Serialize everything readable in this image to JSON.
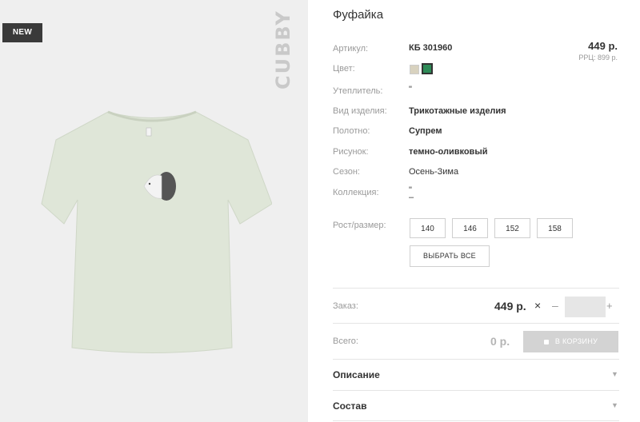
{
  "product": {
    "badge": "NEW",
    "brand": "CUBBY",
    "title": "Фуфайка",
    "price": "449 р.",
    "rrp": "РРЦ: 899 р."
  },
  "specs": {
    "article_label": "Артикул:",
    "article_value": "КБ 301960",
    "color_label": "Цвет:",
    "insulation_label": "Утеплитель:",
    "insulation_value": "\"",
    "type_label": "Вид изделия:",
    "type_value": "Трикотажные изделия",
    "fabric_label": "Полотно:",
    "fabric_value": "Супрем",
    "pattern_label": "Рисунок:",
    "pattern_value": "темно-оливковый",
    "season_label": "Сезон:",
    "season_value": "Осень-Зима",
    "collection_label": "Коллекция:",
    "collection_value": "\"",
    "collection_value2": "–"
  },
  "colors": [
    "#d8d2bf",
    "#2e8b57"
  ],
  "sizes": {
    "label": "Рост/размер:",
    "options": [
      "140",
      "146",
      "152",
      "158"
    ],
    "select_all": "ВЫБРАТЬ ВСЕ"
  },
  "order": {
    "label": "Заказ:",
    "price": "449 р.",
    "times": "×",
    "minus": "–",
    "plus": "+",
    "quantity": ""
  },
  "total": {
    "label": "Всего:",
    "value": "0 р.",
    "cart_button": "В КОРЗИНУ"
  },
  "accordion": {
    "description": "Описание",
    "composition": "Состав"
  }
}
